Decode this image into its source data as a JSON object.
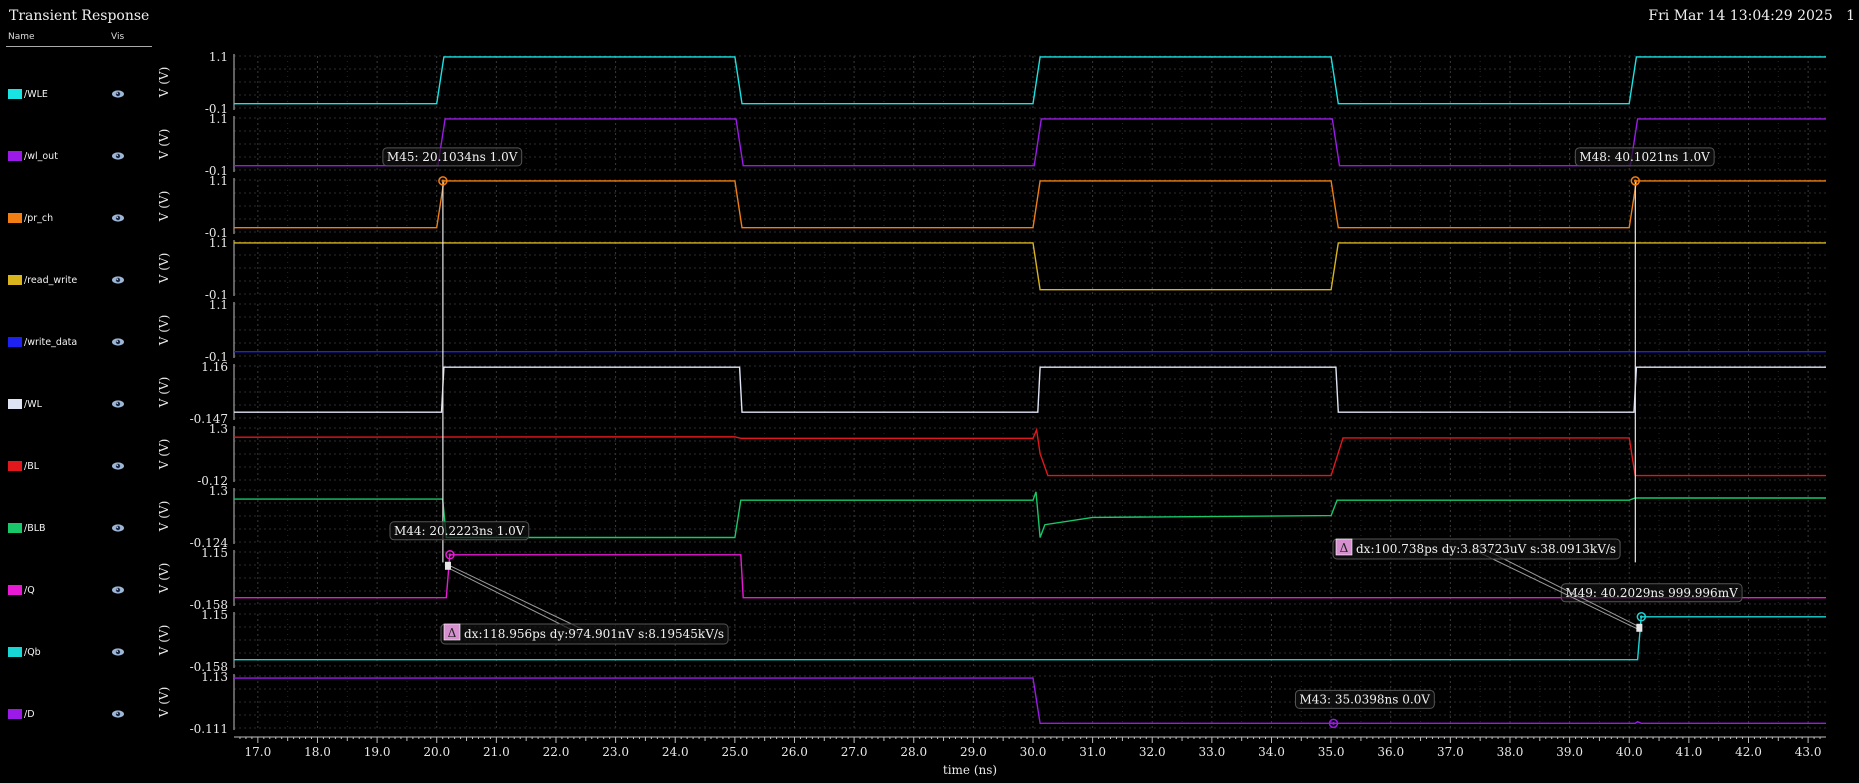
{
  "window": {
    "title": "Transient Response",
    "datetime": "Fri Mar 14 13:04:29 2025   1"
  },
  "legend_header": {
    "name": "Name",
    "vis": "Vis"
  },
  "chart_data": {
    "type": "line",
    "xlabel": "time (ns)",
    "xlim": [
      16.6,
      43.3
    ],
    "x_ticks": [
      "17.0",
      "18.0",
      "19.0",
      "20.0",
      "21.0",
      "22.0",
      "23.0",
      "24.0",
      "25.0",
      "26.0",
      "27.0",
      "28.0",
      "29.0",
      "30.0",
      "31.0",
      "32.0",
      "33.0",
      "34.0",
      "35.0",
      "36.0",
      "37.0",
      "38.0",
      "39.0",
      "40.0",
      "41.0",
      "42.0",
      "43.0"
    ],
    "ylabel": "V (V)",
    "grid": true,
    "series": [
      {
        "name": "/WLE",
        "color": "#19e4e4",
        "ymin_label": "-0.1",
        "ymax_label": "1.1",
        "ylim": [
          -0.1,
          1.1
        ],
        "x": [
          16.6,
          20.0,
          20.12,
          25.0,
          25.12,
          30.0,
          30.12,
          35.0,
          35.12,
          40.0,
          40.12,
          43.3
        ],
        "y": [
          0.0,
          0.0,
          1.08,
          1.08,
          0.0,
          0.0,
          1.08,
          1.08,
          0.0,
          0.0,
          1.08,
          1.08
        ]
      },
      {
        "name": "/wl_out",
        "color": "#9b1ae8",
        "ymin_label": "-0.1",
        "ymax_label": "1.1",
        "ylim": [
          -0.1,
          1.1
        ],
        "x": [
          16.6,
          20.02,
          20.14,
          25.02,
          25.14,
          30.02,
          30.14,
          35.02,
          35.14,
          40.02,
          40.14,
          43.3
        ],
        "y": [
          0.0,
          0.0,
          1.08,
          1.08,
          0.0,
          0.0,
          1.08,
          1.08,
          0.0,
          0.0,
          1.08,
          1.08
        ]
      },
      {
        "name": "/pr_ch",
        "color": "#f07e12",
        "ymin_label": "-0.1",
        "ymax_label": "1.1",
        "ylim": [
          -0.1,
          1.1
        ],
        "x": [
          16.6,
          20.0,
          20.12,
          25.0,
          25.12,
          30.0,
          30.12,
          35.0,
          35.12,
          40.0,
          40.12,
          43.3
        ],
        "y": [
          0.0,
          0.0,
          1.08,
          1.08,
          0.0,
          0.0,
          1.08,
          1.08,
          0.0,
          0.0,
          1.08,
          1.08
        ]
      },
      {
        "name": "/read_write",
        "color": "#d9b41c",
        "ymin_label": "-0.1",
        "ymax_label": "1.1",
        "ylim": [
          -0.1,
          1.1
        ],
        "x": [
          16.6,
          30.0,
          30.12,
          35.0,
          35.12,
          43.3
        ],
        "y": [
          1.08,
          1.08,
          0.0,
          0.0,
          1.08,
          1.08
        ]
      },
      {
        "name": "/write_data",
        "color": "#1e22f0",
        "ymin_label": "-0.1",
        "ymax_label": "1.1",
        "ylim": [
          -0.1,
          1.1
        ],
        "x": [
          16.6,
          43.3
        ],
        "y": [
          0.0,
          0.0
        ]
      },
      {
        "name": "/WL",
        "color": "#dfe4f4",
        "ymin_label": "-0.147",
        "ymax_label": "1.16",
        "ylim": [
          -0.147,
          1.16
        ],
        "x": [
          16.6,
          20.08,
          20.12,
          25.08,
          25.12,
          30.08,
          30.12,
          35.08,
          35.12,
          40.08,
          40.12,
          43.3
        ],
        "y": [
          0.0,
          0.0,
          1.13,
          1.13,
          0.0,
          0.0,
          1.13,
          1.13,
          0.0,
          0.0,
          1.13,
          1.13
        ]
      },
      {
        "name": "/BL",
        "color": "#e0181c",
        "ymin_label": "-0.12",
        "ymax_label": "1.3",
        "ylim": [
          -0.12,
          1.3
        ],
        "x": [
          16.6,
          25.0,
          25.1,
          30.0,
          30.06,
          30.12,
          30.25,
          35.0,
          35.2,
          40.0,
          40.1,
          43.3
        ],
        "y": [
          1.05,
          1.06,
          1.02,
          1.02,
          1.25,
          0.6,
          0.0,
          0.0,
          1.03,
          1.03,
          0.0,
          0.0
        ]
      },
      {
        "name": "/BLB",
        "color": "#17c76a",
        "ymin_label": "-0.124",
        "ymax_label": "1.3",
        "ylim": [
          -0.124,
          1.3
        ],
        "x": [
          16.6,
          20.1,
          20.16,
          25.0,
          25.1,
          30.0,
          30.05,
          30.12,
          30.2,
          31.0,
          35.0,
          35.1,
          40.0,
          40.1,
          43.3
        ],
        "y": [
          1.05,
          1.05,
          0.0,
          0.0,
          1.02,
          1.02,
          1.25,
          0.0,
          0.35,
          0.55,
          0.6,
          1.02,
          1.02,
          1.08,
          1.08
        ]
      },
      {
        "name": "/Q",
        "color": "#e81ad6",
        "ymin_label": "-0.158",
        "ymax_label": "1.15",
        "ylim": [
          -0.158,
          1.15
        ],
        "x": [
          16.6,
          20.16,
          20.22,
          25.1,
          25.14,
          43.3
        ],
        "y": [
          0.0,
          0.0,
          1.08,
          1.08,
          0.0,
          0.0
        ]
      },
      {
        "name": "/Qb",
        "color": "#19d6d6",
        "ymin_label": "-0.158",
        "ymax_label": "1.15",
        "ylim": [
          -0.158,
          1.15
        ],
        "x": [
          16.6,
          40.14,
          40.2,
          43.3
        ],
        "y": [
          0.0,
          0.0,
          1.08,
          1.08
        ]
      },
      {
        "name": "/D",
        "color": "#9b1ae8",
        "ymin_label": "-0.111",
        "ymax_label": "1.13",
        "ylim": [
          -0.111,
          1.13
        ],
        "x": [
          16.6,
          30.0,
          30.12,
          40.1,
          40.14,
          40.2,
          43.3
        ],
        "y": [
          1.08,
          1.08,
          0.0,
          0.0,
          0.04,
          0.0,
          0.0
        ]
      }
    ],
    "markers": [
      {
        "id": "M45",
        "label": "M45: 20.1034ns 1.0V",
        "series": 2,
        "x": 20.1034,
        "y": 1.08,
        "color": "#f07e12"
      },
      {
        "id": "M48",
        "label": "M48: 40.1021ns 1.0V",
        "series": 2,
        "x": 40.1021,
        "y": 1.08,
        "color": "#f07e12"
      },
      {
        "id": "M44",
        "label": "M44: 20.2223ns 1.0V",
        "series": 8,
        "x": 20.2223,
        "y": 1.08,
        "color": "#e81ad6"
      },
      {
        "id": "M49",
        "label": "M49: 40.2029ns 999.996mV",
        "series": 9,
        "x": 40.2029,
        "y": 1.08,
        "color": "#19d6d6"
      },
      {
        "id": "M43",
        "label": "M43: 35.0398ns 0.0V",
        "series": 10,
        "x": 35.0398,
        "y": 0.0,
        "color": "#9b1ae8"
      }
    ],
    "deltas": [
      {
        "label": "dx:118.956ps dy:974.901nV s:8.19545kV/s",
        "from": "M45",
        "to": "M44"
      },
      {
        "label": "dx:100.738ps dy:3.83723uV s:38.0913kV/s",
        "from": "M48",
        "to": "M49"
      }
    ]
  },
  "icons": {
    "visibility": "eye-icon",
    "delta": "delta-icon"
  }
}
